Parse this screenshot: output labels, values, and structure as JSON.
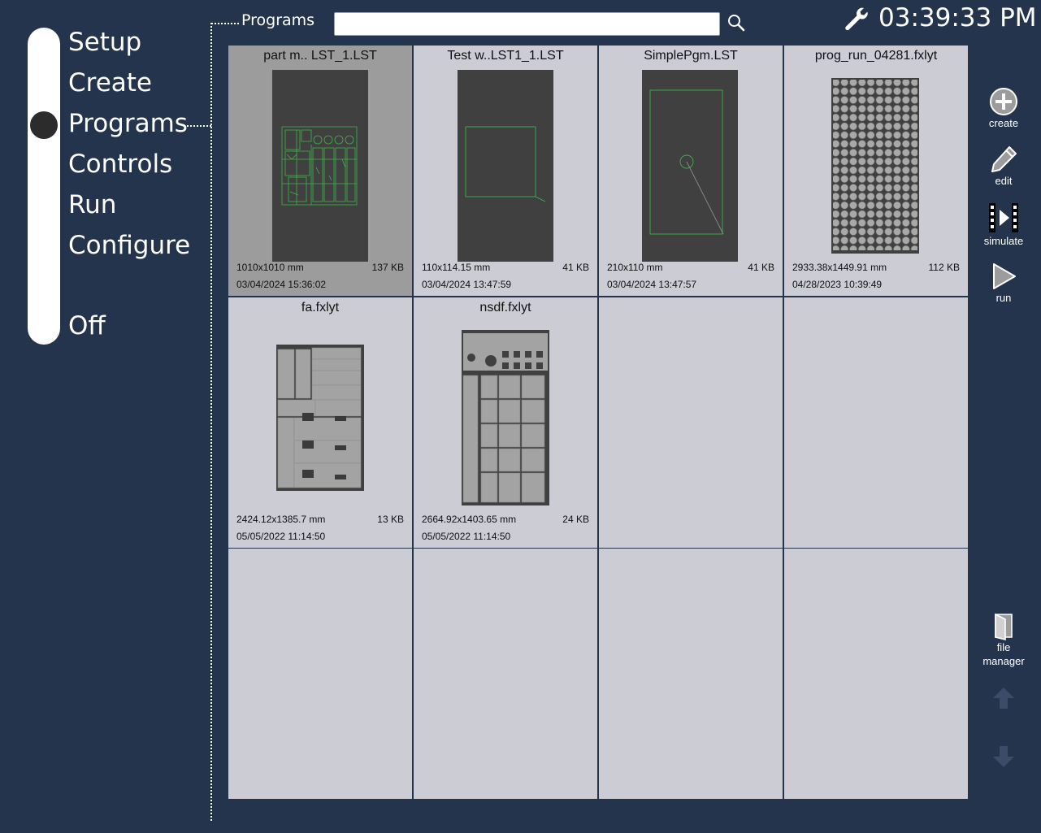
{
  "nav": {
    "items": [
      {
        "label": "Setup"
      },
      {
        "label": "Create"
      },
      {
        "label": "Programs"
      },
      {
        "label": "Controls"
      },
      {
        "label": "Run"
      },
      {
        "label": "Configure"
      },
      {
        "label": "Off"
      }
    ],
    "selected": "Programs"
  },
  "header": {
    "section_title": "Programs",
    "search": {
      "value": "",
      "placeholder": ""
    },
    "search_icon": "magnifier-icon",
    "settings_icon": "wrench-icon",
    "clock": "03:39:33 PM"
  },
  "programs": [
    {
      "name": "part m.. LST_1.LST",
      "dims": "1010x1010 mm",
      "size": "137 KB",
      "date": "03/04/2024 15:36:02",
      "selected": true
    },
    {
      "name": "Test w..LST1_1.LST",
      "dims": "110x114.15 mm",
      "size": "41 KB",
      "date": "03/04/2024 13:47:59",
      "selected": false
    },
    {
      "name": "SimplePgm.LST",
      "dims": "210x110 mm",
      "size": "41 KB",
      "date": "03/04/2024 13:47:57",
      "selected": false
    },
    {
      "name": "prog_run_04281.fxlyt",
      "dims": "2933.38x1449.91 mm",
      "size": "112 KB",
      "date": "04/28/2023 10:39:49",
      "selected": false
    },
    {
      "name": "fa.fxlyt",
      "dims": "2424.12x1385.7 mm",
      "size": "13 KB",
      "date": "05/05/2022 11:14:50",
      "selected": false
    },
    {
      "name": "nsdf.fxlyt",
      "dims": "2664.92x1403.65 mm",
      "size": "24 KB",
      "date": "05/05/2022 11:14:50",
      "selected": false
    }
  ],
  "toolbar": {
    "create": {
      "label": "create",
      "icon": "plus-circle-icon"
    },
    "edit": {
      "label": "edit",
      "icon": "pencil-icon"
    },
    "simulate": {
      "label": "simulate",
      "icon": "film-play-icon"
    },
    "run": {
      "label": "run",
      "icon": "play-icon"
    },
    "file_manager": {
      "label_line1": "file",
      "label_line2": "manager",
      "icon": "folder-door-icon"
    },
    "page_up": {
      "icon": "arrow-up-icon"
    },
    "page_down": {
      "icon": "arrow-down-icon"
    }
  },
  "colors": {
    "background": "#25344d",
    "cell": "#cbccd4",
    "cell_selected": "#9c9c9c",
    "thumb_bg": "#404040",
    "part_green": "#3fb24a"
  }
}
